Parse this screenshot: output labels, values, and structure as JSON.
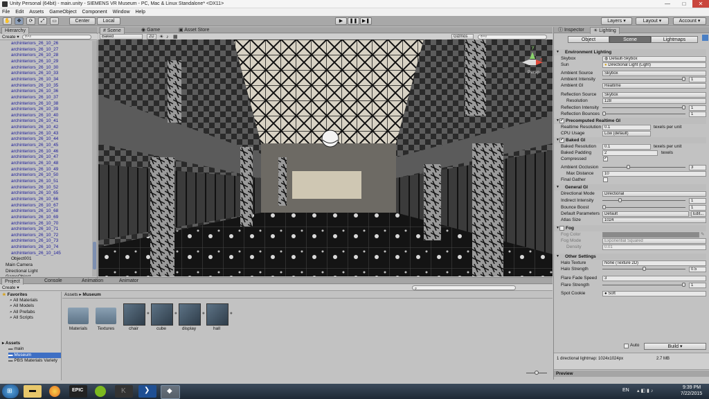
{
  "window": {
    "title": "Unity Personal (64bit) - main.unity - SIEMENS VR Museum - PC, Mac & Linux Standalone* <DX11>",
    "minimize": "—",
    "maximize": "□",
    "close": "✕"
  },
  "menu": [
    "File",
    "Edit",
    "Assets",
    "GameObject",
    "Component",
    "Window",
    "Help"
  ],
  "toolbar": {
    "center_label": "Center",
    "local_label": "Local",
    "layers_label": "Layers",
    "layout_label": "Layout",
    "account_label": "Account",
    "play": "▶",
    "pause": "❚❚",
    "step": "▶❚"
  },
  "hierarchy": {
    "tab": "Hierarchy",
    "create": "Create",
    "search_placeholder": "All",
    "items": [
      "archinteriors_26_10_26",
      "archinteriors_26_10_27",
      "archinteriors_26_10_28",
      "archinteriors_26_10_29",
      "archinteriors_26_10_30",
      "archinteriors_26_10_33",
      "archinteriors_26_10_34",
      "archinteriors_26_10_35",
      "archinteriors_26_10_36",
      "archinteriors_26_10_37",
      "archinteriors_26_10_38",
      "archinteriors_26_10_39",
      "archinteriors_26_10_40",
      "archinteriors_26_10_41",
      "archinteriors_26_10_42",
      "archinteriors_26_10_43",
      "archinteriors_26_10_44",
      "archinteriors_26_10_45",
      "archinteriors_26_10_46",
      "archinteriors_26_10_47",
      "archinteriors_26_10_48",
      "archinteriors_26_10_49",
      "archinteriors_26_10_50",
      "archinteriors_26_10_51",
      "archinteriors_26_10_52",
      "archinteriors_26_10_65",
      "archinteriors_26_10_66",
      "archinteriors_26_10_67",
      "archinteriors_26_10_68",
      "archinteriors_26_10_69",
      "archinteriors_26_10_70",
      "archinteriors_26_10_71",
      "archinteriors_26_10_72",
      "archinteriors_26_10_73",
      "archinteriors_26_10_74",
      "archinteriors_26_10_145"
    ],
    "root_items": [
      "Object001",
      "Main Camera",
      "Directional Light",
      "GameObject"
    ]
  },
  "scene": {
    "tabs": [
      "Scene",
      "Game",
      "Asset Store"
    ],
    "baked": "Baked",
    "mode_2d": "2D",
    "gizmos": "Gizmos",
    "search_placeholder": "All",
    "persp": "Persp",
    "axis_y": "y",
    "axis_x": "x"
  },
  "project": {
    "tabs": [
      "Project",
      "Console",
      "Animation",
      "Animator"
    ],
    "create": "Create",
    "favorites_label": "Favorites",
    "favorites": [
      "All Materials",
      "All Models",
      "All Prefabs",
      "All Scripts"
    ],
    "assets_label": "Assets",
    "asset_folders": [
      "main",
      "Museum",
      "PBS Materials Variety"
    ],
    "breadcrumb": [
      "Assets",
      "Museum"
    ],
    "assets": [
      {
        "name": "Materials",
        "kind": "folder"
      },
      {
        "name": "Textures",
        "kind": "folder"
      },
      {
        "name": "chair",
        "kind": "model"
      },
      {
        "name": "cube",
        "kind": "model"
      },
      {
        "name": "display",
        "kind": "model"
      },
      {
        "name": "hall",
        "kind": "model"
      }
    ]
  },
  "inspector": {
    "tabs": [
      "Inspector",
      "Lighting"
    ],
    "modes": [
      "Object",
      "Scene",
      "Lightmaps"
    ],
    "env_title": "Environment Lighting",
    "skybox_label": "Skybox",
    "skybox_value": "Default-Skybox",
    "sun_label": "Sun",
    "sun_value": "Directional Light (Light)",
    "ambient_source_label": "Ambient Source",
    "ambient_source_value": "Skybox",
    "ambient_intensity_label": "Ambient Intensity",
    "ambient_intensity_value": "1",
    "ambient_intensity_frac": 1.0,
    "ambient_gi_label": "Ambient GI",
    "ambient_gi_value": "Realtime",
    "reflection_source_label": "Reflection Source",
    "reflection_source_value": "Skybox",
    "resolution_label": "Resolution",
    "resolution_value": "128",
    "reflection_intensity_label": "Reflection Intensity",
    "reflection_intensity_value": "1",
    "reflection_intensity_frac": 1.0,
    "reflection_bounces_label": "Reflection Bounces",
    "reflection_bounces_value": "1",
    "reflection_bounces_frac": 0.0,
    "precomputed_title": "Precomputed Realtime GI",
    "realtime_res_label": "Realtime Resolution",
    "realtime_res_value": "0.1",
    "texels_per_unit": "texels per unit",
    "cpu_usage_label": "CPU Usage",
    "cpu_usage_value": "Low (default)",
    "baked_gi_title": "Baked GI",
    "baked_res_label": "Baked Resolution",
    "baked_res_value": "0.1",
    "baked_padding_label": "Baked Padding",
    "baked_padding_value": "2",
    "texels": "texels",
    "compressed_label": "Compressed",
    "ambient_occlusion_label": "Ambient Occlusion",
    "ambient_occlusion_value": "3",
    "ambient_occlusion_frac": 0.3,
    "max_distance_label": "Max Distance",
    "max_distance_value": "10",
    "final_gather_label": "Final Gather",
    "general_gi_title": "General GI",
    "directional_mode_label": "Directional Mode",
    "directional_mode_value": "Directional",
    "indirect_intensity_label": "Indirect Intensity",
    "indirect_intensity_value": "1",
    "indirect_intensity_frac": 0.2,
    "bounce_boost_label": "Bounce Boost",
    "bounce_boost_value": "1",
    "bounce_boost_frac": 0.0,
    "default_parameters_label": "Default Parameters",
    "default_parameters_value": "Default",
    "edit_label": "Edit...",
    "atlas_size_label": "Atlas Size",
    "atlas_size_value": "1024",
    "fog_title": "Fog",
    "fog_color_label": "Fog Color",
    "fog_mode_label": "Fog Mode",
    "fog_mode_value": "Exponential Squared",
    "density_label": "Density",
    "density_value": "0.01",
    "other_title": "Other Settings",
    "halo_texture_label": "Halo Texture",
    "halo_texture_value": "None (Texture 2D)",
    "halo_strength_label": "Halo Strength",
    "halo_strength_value": "0.5",
    "halo_strength_frac": 0.5,
    "flare_fade_label": "Flare Fade Speed",
    "flare_fade_value": "3",
    "flare_strength_label": "Flare Strength",
    "flare_strength_value": "1",
    "flare_strength_frac": 1.0,
    "spot_cookie_label": "Spot Cookie",
    "spot_cookie_value": "Soft",
    "auto_label": "Auto",
    "build_label": "Build",
    "lightmap_info": "1 directional lightmap: 1024x1024px",
    "lightmap_size": "2.7 MB",
    "preview_label": "Preview"
  },
  "taskbar": {
    "lang": "EN",
    "time": "9:39 PM",
    "date": "7/22/2015",
    "icons": [
      "windows-explorer",
      "firefox",
      "epic-games",
      "spotify",
      "k-app",
      "powershell",
      "unity"
    ]
  }
}
